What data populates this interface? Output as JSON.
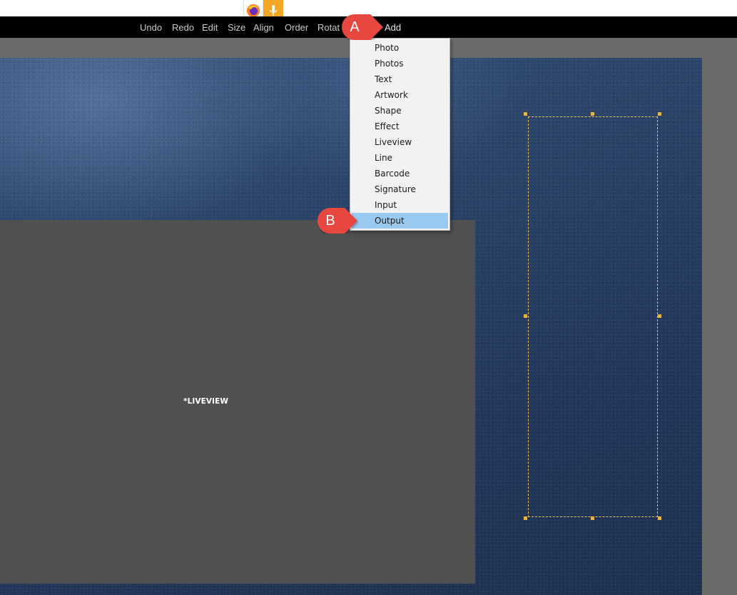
{
  "browser_indicators": [
    {
      "name": "firefox-icon"
    },
    {
      "name": "microphone-icon"
    }
  ],
  "toolbar": {
    "items": [
      "Undo",
      "Redo",
      "Edit",
      "Size",
      "Align",
      "Order",
      "Rotat",
      "Add"
    ]
  },
  "add_menu": {
    "items": [
      "Photo",
      "Photos",
      "Text",
      "Artwork",
      "Shape",
      "Effect",
      "Liveview",
      "Line",
      "Barcode",
      "Signature",
      "Input",
      "Output"
    ],
    "highlighted": "Output"
  },
  "canvas": {
    "liveview_placeholder": "*LIVEVIEW"
  },
  "callouts": [
    "A",
    "B"
  ],
  "colors": {
    "toolbar_bg": "#000000",
    "workspace_bg": "#6b6b6b",
    "canvas_bg": "#2a4368",
    "liveview_bg": "#505050",
    "menu_highlight": "#99c9ef",
    "callout_red": "#e8473f",
    "selection_dashed": "#e6c15a"
  }
}
